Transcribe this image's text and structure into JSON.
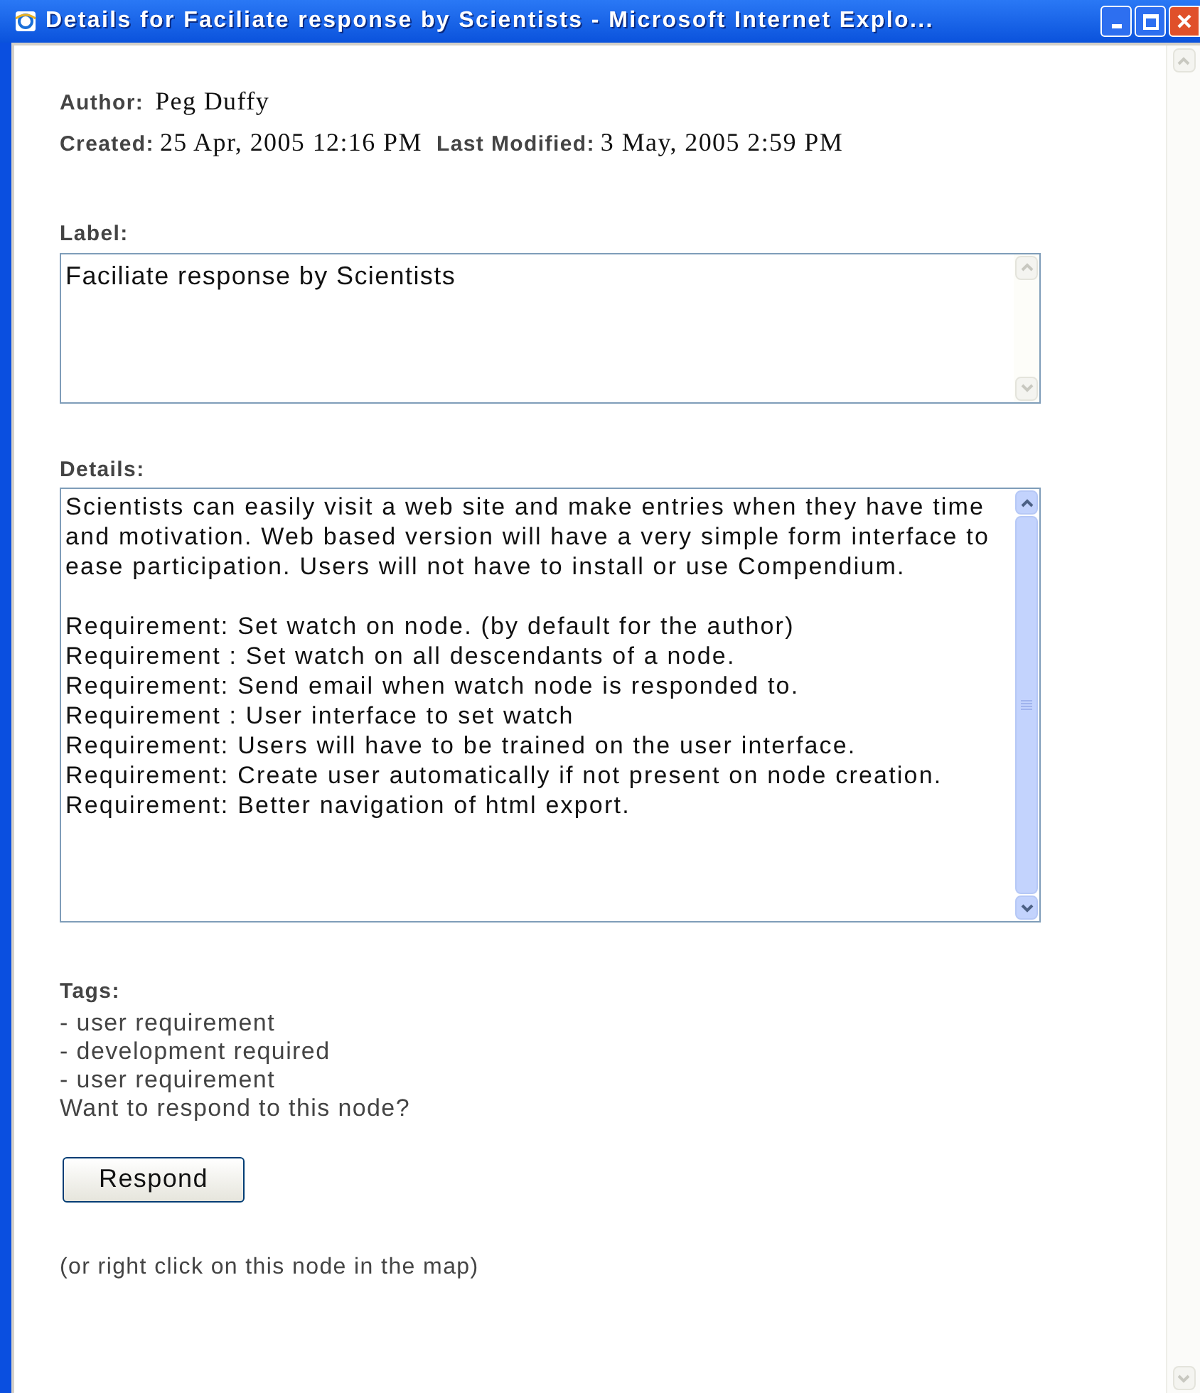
{
  "window": {
    "title": "Details for Faciliate response by Scientists - Microsoft Internet Explo..."
  },
  "meta": {
    "author_label": "Author:",
    "author": "Peg Duffy",
    "created_label": "Created:",
    "created": "25 Apr, 2005 12:16 PM",
    "modified_label": "Last Modified:",
    "modified": "3 May, 2005 2:59 PM"
  },
  "label_field": {
    "heading": "Label:",
    "value": "Faciliate response by Scientists"
  },
  "details_field": {
    "heading": "Details:",
    "paragraph": "Scientists can easily visit a web site and make entries when they have time and motivation. Web based version will have a very simple form interface to ease participation. Users will not have to install or use Compendium.",
    "lines": [
      "Requirement: Set watch on node. (by default for the author)",
      "Requirement : Set watch on all descendants of a node.",
      "Requirement: Send email when watch node is responded to.",
      "Requirement : User interface to set watch",
      "Requirement: Users will have to be trained on the user interface.",
      "Requirement: Create user automatically if not present on node creation.",
      "Requirement: Better navigation of html export."
    ]
  },
  "tags": {
    "heading": "Tags:",
    "items": [
      "- user requirement",
      "- development required",
      "- user requirement"
    ]
  },
  "prompt": "Want to respond to this node?",
  "respond_button": "Respond",
  "footnote": "(or right click on this node in the map)"
}
